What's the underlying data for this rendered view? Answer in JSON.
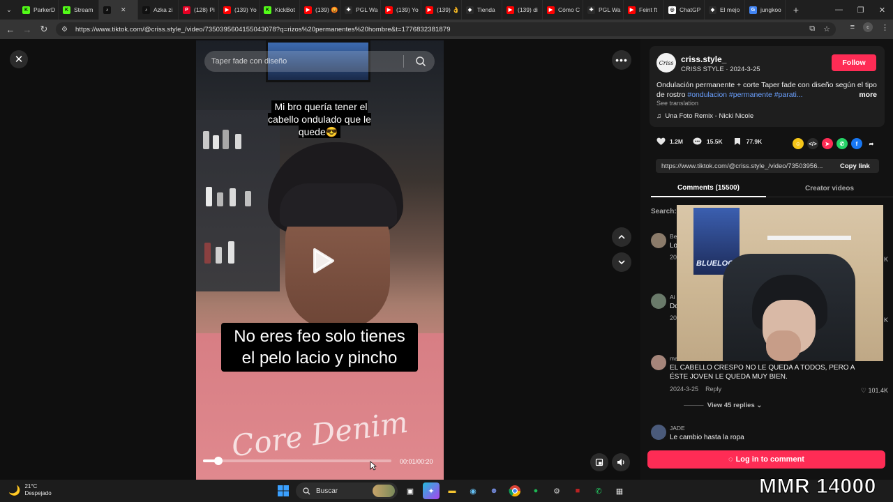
{
  "browser": {
    "tabs": [
      {
        "label": "ParkerD",
        "color": "#53fc18",
        "glyph": "K"
      },
      {
        "label": "Stream",
        "color": "#53fc18",
        "glyph": "K"
      },
      {
        "label": "",
        "color": "#111111",
        "glyph": "♪",
        "active": true
      },
      {
        "label": "Azka zi",
        "color": "#111111",
        "glyph": "♪"
      },
      {
        "label": "(128) Pi",
        "color": "#e60023",
        "glyph": "P"
      },
      {
        "label": "(139) Yo",
        "color": "#ff0000",
        "glyph": "▶"
      },
      {
        "label": "KickBot",
        "color": "#53fc18",
        "glyph": "K"
      },
      {
        "label": "(139) 😡",
        "color": "#ff0000",
        "glyph": "▶"
      },
      {
        "label": "PGL Wa",
        "color": "#2b2b2b",
        "glyph": "✚"
      },
      {
        "label": "(139) Yo",
        "color": "#ff0000",
        "glyph": "▶"
      },
      {
        "label": "(139) 👌",
        "color": "#ff0000",
        "glyph": "▶"
      },
      {
        "label": "Tienda",
        "color": "#2b2b2b",
        "glyph": "◆"
      },
      {
        "label": "(139) di",
        "color": "#ff0000",
        "glyph": "▶"
      },
      {
        "label": "Cómo C",
        "color": "#ff0000",
        "glyph": "▶"
      },
      {
        "label": "PGL Wa",
        "color": "#2b2b2b",
        "glyph": "✚"
      },
      {
        "label": "Feint ft",
        "color": "#ff0000",
        "glyph": "▶"
      },
      {
        "label": "ChatGP",
        "color": "#ffffff",
        "glyph": "◎"
      },
      {
        "label": "El mejo",
        "color": "#2b2b2b",
        "glyph": "◆"
      },
      {
        "label": "jungkoo",
        "color": "#4285f4",
        "glyph": "G"
      }
    ],
    "url": "https://www.tiktok.com/@criss.style_/video/7350395604155043078?q=rizos%20permanentes%20hombre&t=1776832381879"
  },
  "video": {
    "search_placeholder": "Taper fade con diseño",
    "caption_top": "Mi bro quería tener el cabello ondulado que le quede😎",
    "caption_bottom": "No eres feo solo  tienes el pelo lacio y pincho",
    "shirt_text": "Core Denim",
    "time": "00:01/00:20",
    "progress": 0.08
  },
  "post": {
    "handle": "criss.style_",
    "avatar_text": "Criss",
    "name_date": "CRISS STYLE · 2024-3-25",
    "follow_label": "Follow",
    "description": "Ondulación permanente + corte Taper fade con diseño según el tipo de rostro ",
    "tags": "#ondulacion #permanente #parati...",
    "more_label": "more",
    "see_translation": "See translation",
    "music": "Una Foto Remix - Nicki Nicole",
    "likes": "1.2M",
    "comments": "15.5K",
    "saves": "77.9K",
    "share_url": "https://www.tiktok.com/@criss.style_/video/73503956...",
    "copy_link": "Copy link",
    "tab_comments": "Comments (15500)",
    "tab_creator": "Creator videos",
    "search_label": "Search:",
    "login_label": "Log in to comment"
  },
  "comments": [
    {
      "user": "Be",
      "text": "Lo",
      "date": "20",
      "likes": "K"
    },
    {
      "user": "Ai",
      "text": "Do",
      "date": "20",
      "likes": "K"
    },
    {
      "user": "marian...",
      "text": "EL CABELLO CRESPO NO LE QUEDA A TODOS, PERO A ÉSTE JOVEN LE QUEDA MUY BIEN.",
      "date": "2024-3-25",
      "reply": "Reply",
      "likes": "101.4K",
      "replies": "View 45 replies"
    },
    {
      "user": "JADE",
      "text": "Le cambio hasta la ropa",
      "date": "",
      "likes": ""
    }
  ],
  "webcam": {
    "poster_text": "BLUELOCK"
  },
  "taskbar": {
    "temp": "21°C",
    "weather": "Despejado",
    "search": "Buscar"
  },
  "overlay": {
    "mmr": "MMR 14000"
  }
}
